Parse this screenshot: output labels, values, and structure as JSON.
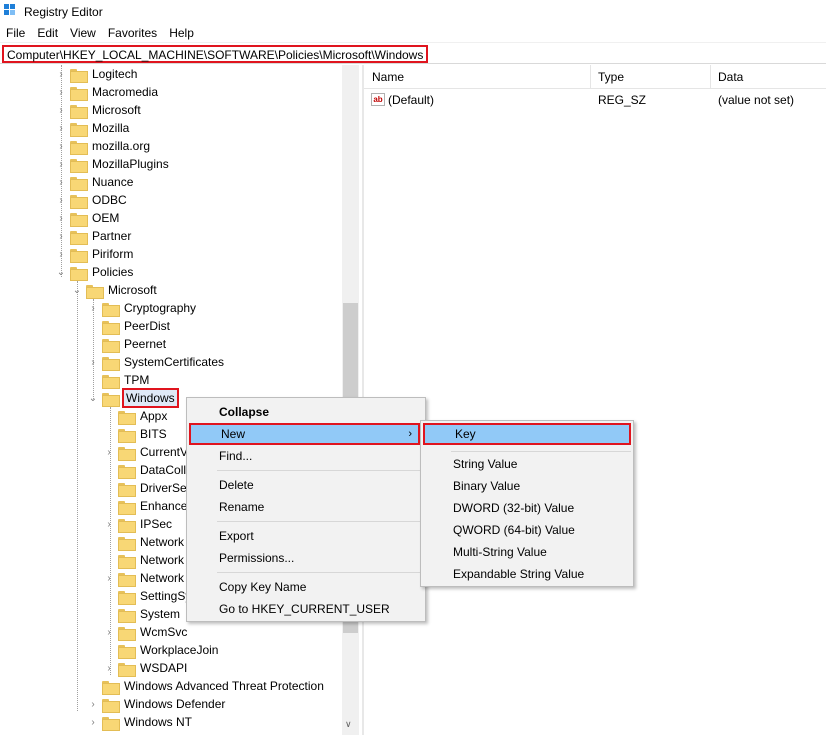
{
  "window": {
    "title": "Registry Editor"
  },
  "menu": [
    "File",
    "Edit",
    "View",
    "Favorites",
    "Help"
  ],
  "address": "Computer\\HKEY_LOCAL_MACHINE\\SOFTWARE\\Policies\\Microsoft\\Windows",
  "tree": [
    {
      "label": "Logitech",
      "chevron": "›"
    },
    {
      "label": "Macromedia",
      "chevron": "›"
    },
    {
      "label": "Microsoft",
      "chevron": "›"
    },
    {
      "label": "Mozilla",
      "chevron": "›"
    },
    {
      "label": "mozilla.org",
      "chevron": "›"
    },
    {
      "label": "MozillaPlugins",
      "chevron": "›"
    },
    {
      "label": "Nuance",
      "chevron": "›"
    },
    {
      "label": "ODBC",
      "chevron": "›"
    },
    {
      "label": "OEM",
      "chevron": "›"
    },
    {
      "label": "Partner",
      "chevron": "›"
    },
    {
      "label": "Piriform",
      "chevron": "›"
    },
    {
      "label": "Policies",
      "chevron": "⌄"
    },
    {
      "label": "Microsoft",
      "chevron": "⌄"
    },
    {
      "label": "Cryptography",
      "chevron": "›"
    },
    {
      "label": "PeerDist",
      "chevron": ""
    },
    {
      "label": "Peernet",
      "chevron": ""
    },
    {
      "label": "SystemCertificates",
      "chevron": "›"
    },
    {
      "label": "TPM",
      "chevron": ""
    },
    {
      "label": "Windows",
      "chevron": "⌄"
    },
    {
      "label": "Appx",
      "chevron": ""
    },
    {
      "label": "BITS",
      "chevron": ""
    },
    {
      "label": "CurrentV",
      "chevron": "›"
    },
    {
      "label": "DataColle",
      "chevron": ""
    },
    {
      "label": "DriverSea",
      "chevron": ""
    },
    {
      "label": "Enhance",
      "chevron": ""
    },
    {
      "label": "IPSec",
      "chevron": "›"
    },
    {
      "label": "Network",
      "chevron": ""
    },
    {
      "label": "Network",
      "chevron": ""
    },
    {
      "label": "Network",
      "chevron": "›"
    },
    {
      "label": "SettingSy",
      "chevron": ""
    },
    {
      "label": "System",
      "chevron": ""
    },
    {
      "label": "WcmSvc",
      "chevron": "›"
    },
    {
      "label": "WorkplaceJoin",
      "chevron": ""
    },
    {
      "label": "WSDAPI",
      "chevron": "›"
    },
    {
      "label": "Windows Advanced Threat Protection",
      "chevron": ""
    },
    {
      "label": "Windows Defender",
      "chevron": "›"
    },
    {
      "label": "Windows NT",
      "chevron": "›"
    }
  ],
  "list": {
    "headers": [
      "Name",
      "Type",
      "Data"
    ],
    "rows": [
      {
        "name": "(Default)",
        "type": "REG_SZ",
        "data": "(value not set)",
        "icon_text": "ab"
      }
    ]
  },
  "context_menu": {
    "collapse": "Collapse",
    "new": "New",
    "find": "Find...",
    "delete": "Delete",
    "rename": "Rename",
    "export": "Export",
    "permissions": "Permissions...",
    "copy_key_name": "Copy Key Name",
    "goto": "Go to HKEY_CURRENT_USER",
    "submenu_arrow": "›"
  },
  "submenu": {
    "key": "Key",
    "string": "String Value",
    "binary": "Binary Value",
    "dword": "DWORD (32-bit) Value",
    "qword": "QWORD (64-bit) Value",
    "multi": "Multi-String Value",
    "expandable": "Expandable String Value"
  },
  "colors": {
    "highlight_outline": "#e0141e",
    "menu_hover": "#91c9f7",
    "folder": "#f8d775"
  }
}
